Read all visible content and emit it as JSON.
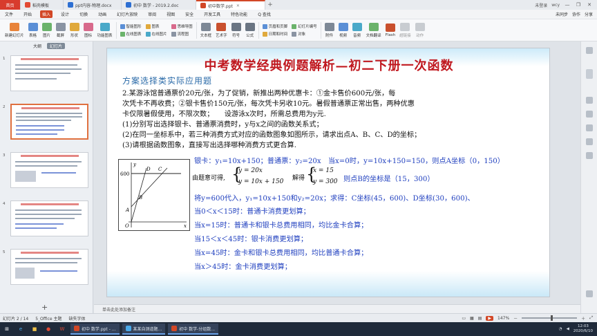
{
  "tabs": [
    {
      "label": "首页"
    },
    {
      "label": "稻壳模板"
    },
    {
      "label": "ppt内容-物理.docx"
    },
    {
      "label": "初中 数学 - 2019.2.doc"
    },
    {
      "label": "初中数学.ppt"
    }
  ],
  "tab_right": {
    "login": "未登录",
    "user": "wcy"
  },
  "menu": {
    "file": "文件",
    "items": [
      "开始",
      "插入",
      "设计",
      "切换",
      "动画",
      "幻灯片放映",
      "审阅",
      "视图",
      "安全",
      "开发工具",
      "特色功能"
    ],
    "active_index": 1,
    "search": "Q 查找",
    "right": [
      "未同步",
      "协作",
      "分享"
    ]
  },
  "ribbon": {
    "big": [
      "新建幻灯片",
      "表格",
      "图片",
      "截屏",
      "形状",
      "图标",
      "功能图表"
    ],
    "small1": [
      "智能图形",
      "在线图表",
      "图表"
    ],
    "small2": [
      "思维导图",
      "流程图",
      "在线图片"
    ],
    "big2": [
      "文本框",
      "艺术字",
      "符号",
      "公式"
    ],
    "small3": [
      "页眉和页脚",
      "日期和时间",
      "幻灯片编号",
      "对象"
    ],
    "big3": [
      "附件",
      "视频",
      "音频",
      "文档翻译",
      "Flash",
      "超链接",
      "动作"
    ]
  },
  "leftpane": {
    "tab_outline": "大纲",
    "tab_slides": "幻灯片",
    "numbers": [
      "1",
      "2",
      "3",
      "4",
      "5"
    ]
  },
  "slide": {
    "title": "中考数学经典例题解析—初二下册一次函数",
    "subtitle": "方案选择类实际应用题",
    "problem": [
      "2.某游泳馆普通票价20元/张，为了促销，新推出两种优惠卡：①金卡售价600元/张，每",
      "次凭卡不再收费；②银卡售价150元/张，每次凭卡另收10元。暑假普通票正常出售，两种优惠",
      "卡仅限暑假使用，不限次数；　　设游泳x次时，所需总费用为y元.",
      "(1)分别写出选择银卡、普通票消费时，y与x之间的函数关系式；",
      "(2)在同一坐标系中，若三种消费方式对应的函数图象如图所示，请求出点A、B、C、D的坐标；",
      "(3)请根据函数图象，直接写出选择哪种消费方式更合算."
    ],
    "graph": {
      "y600": "600",
      "A": "A",
      "B": "B",
      "C": "C",
      "D": "D",
      "O": "O",
      "x": "x",
      "y": "y"
    },
    "sol1": "银卡：y₁=10x+150；普通票：y₂=20x　当x=0时，y=10x+150=150，则点A坐标（0，150）",
    "sol2a": "由题意可得,",
    "eq1": "y = 20x",
    "eq2": "y = 10x + 150",
    "sol2b": "解得",
    "eq3": "x = 15",
    "eq4": "y = 300",
    "sol2c": "则点B的坐标是（15，300）",
    "sol3": "将y=600代入，y₁=10x+150和y₂=20x；求得：C坐标(45，600)、D坐标(30，600)、",
    "sol4": "当0＜x＜15时：普通卡消费更划算；",
    "sol5": "当x=15时：普通卡和银卡总费用相同，均比金卡合算；",
    "sol6": "当15＜x＜45时：银卡消费更划算；",
    "sol7": "当x=45时：金卡和银卡总费用相同，均比普通卡合算；",
    "sol8": "当x＞45时：金卡消费更划算；"
  },
  "notes": "单击此处添加备注",
  "status": {
    "slide": "幻灯片 2 / 14",
    "theme": "5_Office 主题",
    "font": "缺失字体",
    "zoom": "147%"
  },
  "taskbar": {
    "apps": [
      "初中 数学.ppt - ...",
      "某某自测道题...",
      "初中 数学-分组数..."
    ],
    "time": "12:03",
    "date": "2020/6/10"
  },
  "colors": {
    "accent": "#d24726",
    "title": "#c0181f",
    "solution": "#1f3fbf",
    "subtitle": "#2a6aa8"
  }
}
